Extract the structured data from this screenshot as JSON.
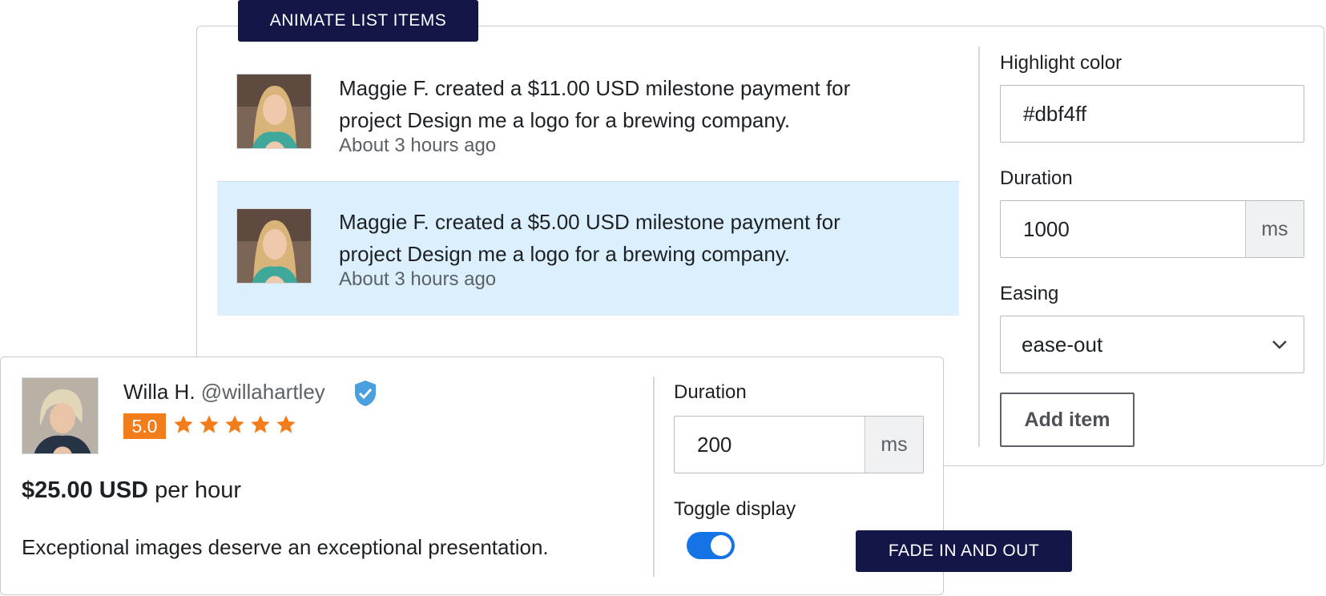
{
  "animate_list": {
    "tag": "ANIMATE LIST ITEMS",
    "items": [
      {
        "line1": "Maggie F. created a $11.00 USD milestone payment for",
        "line2": "project Design me a logo for a brewing company.",
        "time": "About 3 hours ago",
        "highlighted": false
      },
      {
        "line1": "Maggie F. created a $5.00 USD milestone payment for",
        "line2": "project Design me a logo for a brewing company.",
        "time": "About 3 hours ago",
        "highlighted": true
      }
    ],
    "controls": {
      "highlight_label": "Highlight color",
      "highlight_value": "#dbf4ff",
      "duration_label": "Duration",
      "duration_value": "1000",
      "duration_unit": "ms",
      "easing_label": "Easing",
      "easing_value": "ease-out",
      "add_button": "Add item"
    }
  },
  "fade": {
    "tag": "FADE IN AND OUT",
    "profile": {
      "name": "Willa H.",
      "handle": "@willahartley",
      "rating": "5.0",
      "stars": 5,
      "rate_amount": "$25.00 USD",
      "rate_unit": "per hour",
      "tagline": "Exceptional images deserve an exceptional presentation."
    },
    "controls": {
      "duration_label": "Duration",
      "duration_value": "200",
      "duration_unit": "ms",
      "toggle_label": "Toggle display",
      "toggle_on": true
    }
  },
  "colors": {
    "tag_bg": "#131646",
    "highlight": "#dbf0fc",
    "star": "#f37d1b",
    "verified": "#4a9fe0",
    "toggle": "#1673e6"
  }
}
